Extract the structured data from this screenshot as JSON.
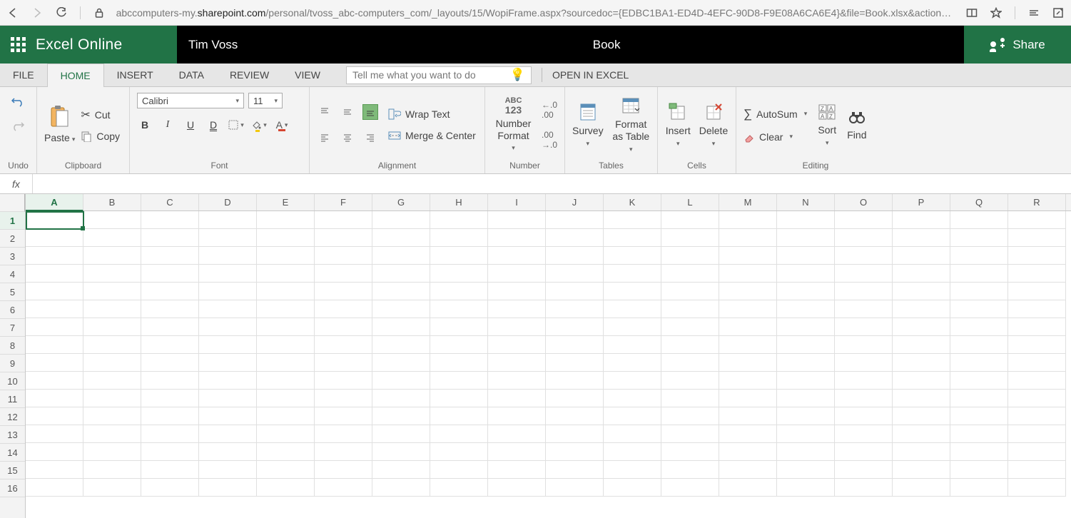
{
  "browser": {
    "url_prefix": "abccomputers-my.",
    "url_bold": "sharepoint.com",
    "url_suffix": "/personal/tvoss_abc-computers_com/_layouts/15/WopiFrame.aspx?sourcedoc={EDBC1BA1-ED4D-4EFC-90D8-F9E08A6CA6E4}&file=Book.xlsx&action=default"
  },
  "header": {
    "app_name": "Excel Online",
    "user_name": "Tim Voss",
    "doc_name": "Book",
    "share_label": "Share"
  },
  "tabs": {
    "items": [
      "FILE",
      "HOME",
      "INSERT",
      "DATA",
      "REVIEW",
      "VIEW"
    ],
    "active_index": 1,
    "tellme_placeholder": "Tell me what you want to do",
    "open_in_excel": "OPEN IN EXCEL"
  },
  "ribbon": {
    "undo_label": "Undo",
    "clipboard": {
      "paste": "Paste",
      "cut": "Cut",
      "copy": "Copy",
      "label": "Clipboard"
    },
    "font": {
      "name": "Calibri",
      "size": "11",
      "label": "Font"
    },
    "alignment": {
      "wrap": "Wrap Text",
      "merge": "Merge & Center",
      "label": "Alignment"
    },
    "number": {
      "format": "Number Format",
      "label": "Number"
    },
    "tables": {
      "survey": "Survey",
      "format_as_table": "Format as Table",
      "label": "Tables"
    },
    "cells": {
      "insert": "Insert",
      "delete": "Delete",
      "label": "Cells"
    },
    "editing": {
      "autosum": "AutoSum",
      "clear": "Clear",
      "sort": "Sort",
      "find": "Find",
      "label": "Editing"
    }
  },
  "formula_bar": {
    "fx": "fx",
    "value": ""
  },
  "sheet": {
    "columns": [
      "A",
      "B",
      "C",
      "D",
      "E",
      "F",
      "G",
      "H",
      "I",
      "J",
      "K",
      "L",
      "M",
      "N",
      "O",
      "P",
      "Q",
      "R"
    ],
    "rows": [
      "1",
      "2",
      "3",
      "4",
      "5",
      "6",
      "7",
      "8",
      "9",
      "10",
      "11",
      "12",
      "13",
      "14",
      "15",
      "16"
    ],
    "active_col_index": 0,
    "active_row_index": 0
  }
}
